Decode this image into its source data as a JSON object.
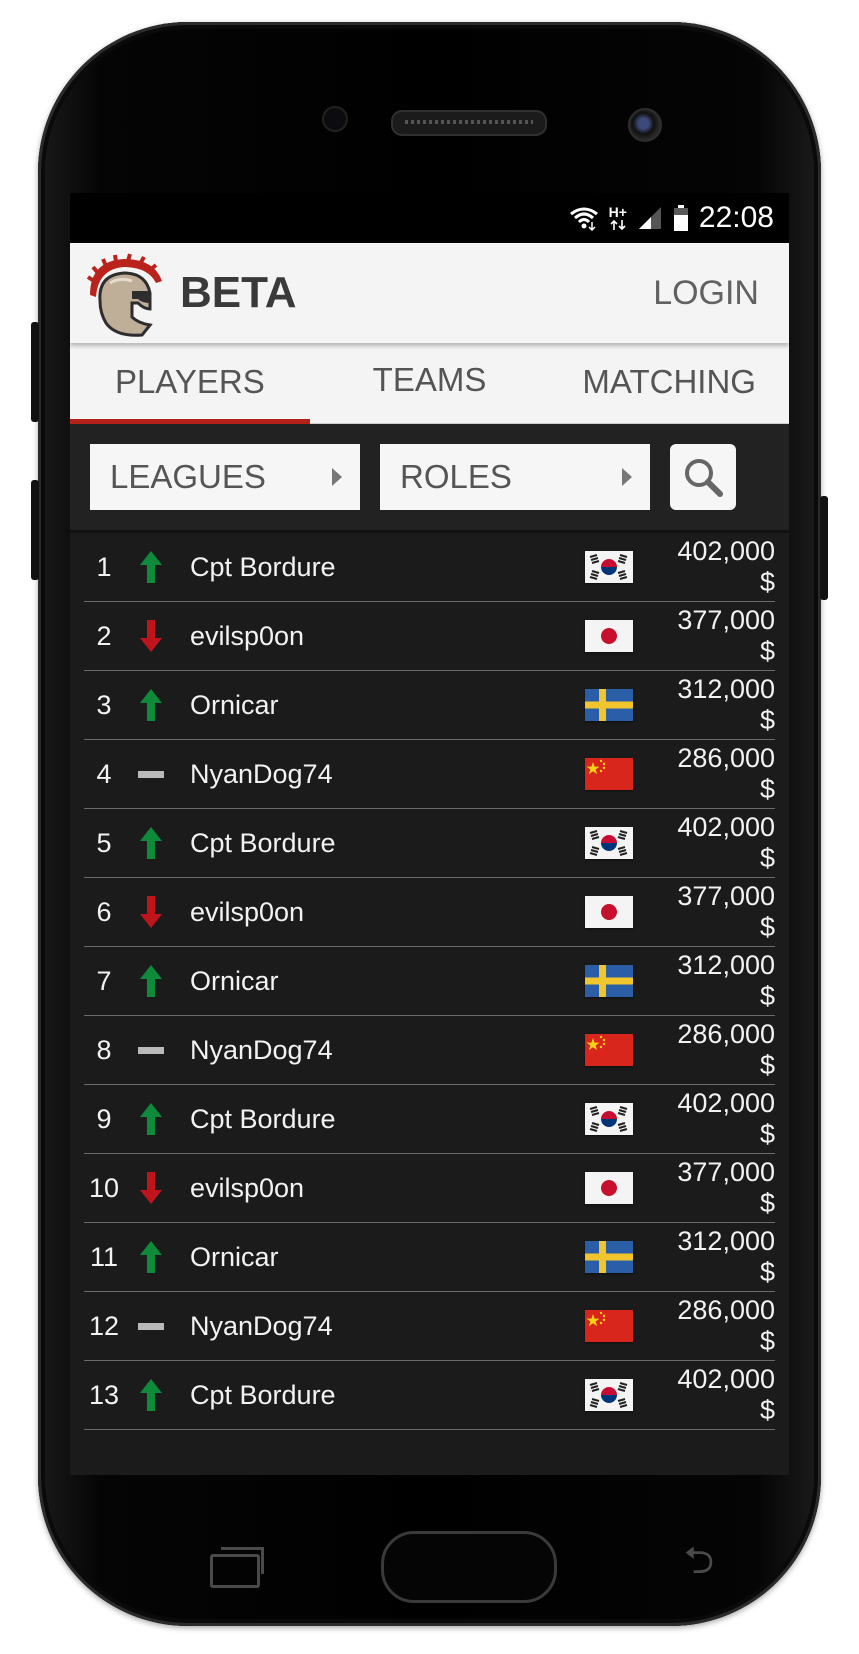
{
  "status_bar": {
    "time": "22:08",
    "network": "H+"
  },
  "header": {
    "title": "BETA",
    "login_label": "LOGIN"
  },
  "tabs": [
    {
      "label": "PLAYERS",
      "active": true
    },
    {
      "label": "TEAMS",
      "active": false
    },
    {
      "label": "MATCHING",
      "active": false
    }
  ],
  "filters": {
    "leagues_label": "LEAGUES",
    "roles_label": "ROLES",
    "search_icon": "search-icon"
  },
  "colors": {
    "up": "#0e8a3a",
    "down": "#c0141c",
    "same": "#b9b9b9",
    "accent": "#b4201a"
  },
  "players": [
    {
      "rank": "1",
      "trend": "up",
      "name": "Cpt Bordure",
      "flag": "south-korea",
      "value": "402,000 $"
    },
    {
      "rank": "2",
      "trend": "down",
      "name": "evilsp0on",
      "flag": "japan",
      "value": "377,000 $"
    },
    {
      "rank": "3",
      "trend": "up",
      "name": "Ornicar",
      "flag": "sweden",
      "value": "312,000 $"
    },
    {
      "rank": "4",
      "trend": "same",
      "name": "NyanDog74",
      "flag": "china",
      "value": "286,000 $"
    },
    {
      "rank": "5",
      "trend": "up",
      "name": "Cpt Bordure",
      "flag": "south-korea",
      "value": "402,000 $"
    },
    {
      "rank": "6",
      "trend": "down",
      "name": "evilsp0on",
      "flag": "japan",
      "value": "377,000 $"
    },
    {
      "rank": "7",
      "trend": "up",
      "name": "Ornicar",
      "flag": "sweden",
      "value": "312,000 $"
    },
    {
      "rank": "8",
      "trend": "same",
      "name": "NyanDog74",
      "flag": "china",
      "value": "286,000 $"
    },
    {
      "rank": "9",
      "trend": "up",
      "name": "Cpt Bordure",
      "flag": "south-korea",
      "value": "402,000 $"
    },
    {
      "rank": "10",
      "trend": "down",
      "name": "evilsp0on",
      "flag": "japan",
      "value": "377,000 $"
    },
    {
      "rank": "11",
      "trend": "up",
      "name": "Ornicar",
      "flag": "sweden",
      "value": "312,000 $"
    },
    {
      "rank": "12",
      "trend": "same",
      "name": "NyanDog74",
      "flag": "china",
      "value": "286,000 $"
    },
    {
      "rank": "13",
      "trend": "up",
      "name": "Cpt Bordure",
      "flag": "south-korea",
      "value": "402,000 $"
    }
  ]
}
